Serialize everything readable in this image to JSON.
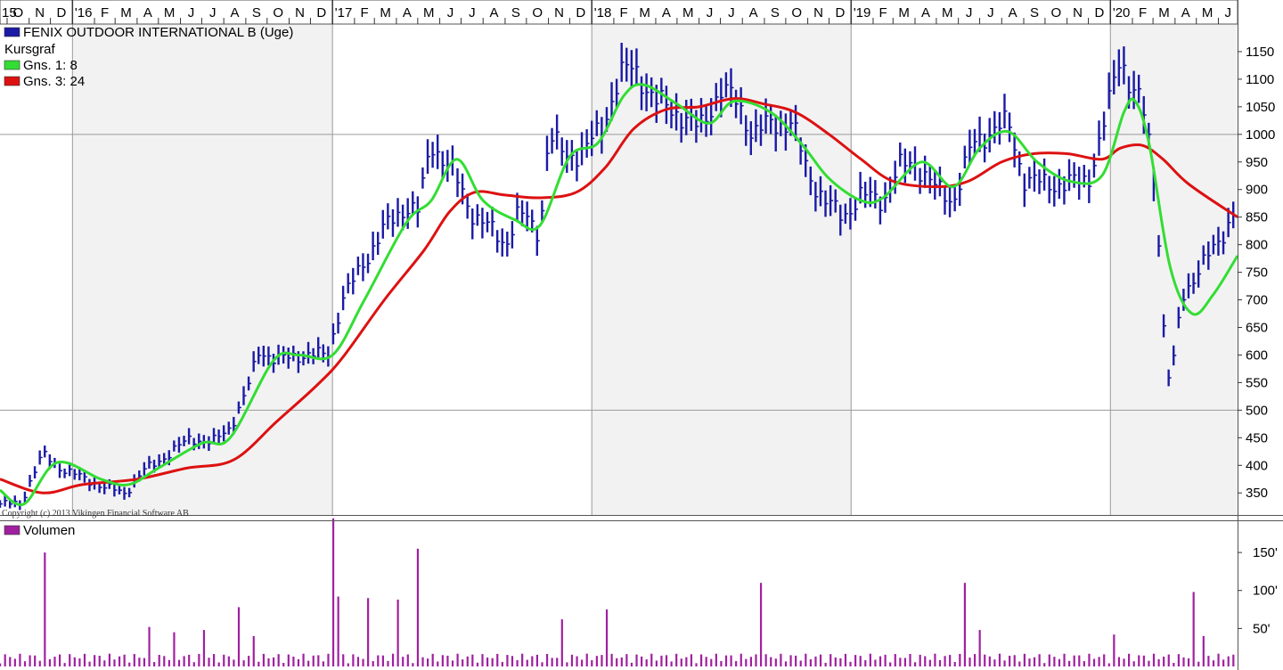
{
  "colors": {
    "price": "#1a1aa6",
    "ma_short": "#33dd33",
    "ma_long": "#dd1111",
    "volume": "#a020a0",
    "grid": "#9a9a9a",
    "band": "#f2f2f2"
  },
  "time_axis": {
    "labels": [
      "15",
      "O",
      "N",
      "D",
      "'16",
      "F",
      "M",
      "A",
      "M",
      "J",
      "J",
      "A",
      "S",
      "O",
      "N",
      "D",
      "'17",
      "F",
      "M",
      "A",
      "M",
      "J",
      "J",
      "A",
      "S",
      "O",
      "N",
      "D",
      "'18",
      "F",
      "M",
      "A",
      "M",
      "J",
      "J",
      "A",
      "S",
      "O",
      "N",
      "D",
      "'19",
      "F",
      "M",
      "A",
      "M",
      "J",
      "J",
      "A",
      "S",
      "O",
      "N",
      "D",
      "'20",
      "F",
      "M",
      "A",
      "M",
      "J"
    ]
  },
  "legend": {
    "title": "FENIX OUTDOOR INTERNATIONAL B (Uge)",
    "subtitle": "Kursgraf",
    "ma_short_label": "Gns. 1: 8",
    "ma_long_label": "Gns. 3: 24",
    "volume_label": "Volumen"
  },
  "copyright": "Copyright (c) 2013 Vikingen Financial Software AB",
  "chart_data": [
    {
      "type": "line",
      "title": "FENIX OUTDOOR INTERNATIONAL B (Uge)",
      "x_range": [
        "2015-09-21",
        "2020-06-28"
      ],
      "ylim": [
        310,
        1200
      ],
      "y_ticks": [
        350,
        400,
        450,
        500,
        550,
        600,
        650,
        700,
        750,
        800,
        850,
        900,
        950,
        1000,
        1050,
        1100,
        1150
      ],
      "y_gridlines": [
        500,
        1000
      ],
      "x_gridlines": [
        "2016-01-01",
        "2017-01-01",
        "2018-01-01",
        "2019-01-01",
        "2020-01-01"
      ],
      "series": [
        {
          "name": "FENIX OUTDOOR INTERNATIONAL B (Uge)",
          "style": "hlc-bars",
          "anchors": [
            [
              "2015-09-21",
              330
            ],
            [
              "2015-10-20",
              330
            ],
            [
              "2015-11-05",
              380
            ],
            [
              "2015-11-20",
              420
            ],
            [
              "2015-12-15",
              395
            ],
            [
              "2016-01-10",
              380
            ],
            [
              "2016-02-15",
              360
            ],
            [
              "2016-03-15",
              350
            ],
            [
              "2016-04-10",
              390
            ],
            [
              "2016-05-15",
              420
            ],
            [
              "2016-06-15",
              450
            ],
            [
              "2016-07-15",
              440
            ],
            [
              "2016-08-10",
              470
            ],
            [
              "2016-09-01",
              530
            ],
            [
              "2016-09-20",
              610
            ],
            [
              "2016-10-15",
              590
            ],
            [
              "2016-11-15",
              600
            ],
            [
              "2016-12-25",
              600
            ],
            [
              "2017-01-15",
              700
            ],
            [
              "2017-02-15",
              770
            ],
            [
              "2017-03-15",
              830
            ],
            [
              "2017-04-15",
              870
            ],
            [
              "2017-05-01",
              860
            ],
            [
              "2017-05-20",
              985
            ],
            [
              "2017-06-20",
              930
            ],
            [
              "2017-07-15",
              860
            ],
            [
              "2017-08-10",
              830
            ],
            [
              "2017-09-01",
              800
            ],
            [
              "2017-09-20",
              860
            ],
            [
              "2017-10-20",
              820
            ],
            [
              "2017-11-01",
              1000
            ],
            [
              "2017-11-25",
              960
            ],
            [
              "2017-12-20",
              970
            ],
            [
              "2018-01-15",
              1010
            ],
            [
              "2018-02-10",
              1110
            ],
            [
              "2018-03-01",
              1120
            ],
            [
              "2018-04-01",
              1060
            ],
            [
              "2018-05-01",
              1040
            ],
            [
              "2018-06-01",
              1010
            ],
            [
              "2018-07-01",
              1080
            ],
            [
              "2018-07-25",
              1060
            ],
            [
              "2018-08-15",
              1000
            ],
            [
              "2018-09-10",
              1020
            ],
            [
              "2018-10-10",
              1020
            ],
            [
              "2018-11-01",
              930
            ],
            [
              "2018-11-25",
              880
            ],
            [
              "2018-12-20",
              850
            ],
            [
              "2019-01-15",
              890
            ],
            [
              "2019-02-15",
              880
            ],
            [
              "2019-03-10",
              940
            ],
            [
              "2019-04-01",
              950
            ],
            [
              "2019-05-01",
              900
            ],
            [
              "2019-05-25",
              880
            ],
            [
              "2019-06-20",
              980
            ],
            [
              "2019-07-20",
              1010
            ],
            [
              "2019-08-10",
              1020
            ],
            [
              "2019-09-01",
              920
            ],
            [
              "2019-10-01",
              910
            ],
            [
              "2019-11-01",
              910
            ],
            [
              "2019-12-01",
              920
            ],
            [
              "2019-12-20",
              1000
            ],
            [
              "2020-01-15",
              1150
            ],
            [
              "2020-01-25",
              1100
            ],
            [
              "2020-02-15",
              1050
            ],
            [
              "2020-02-28",
              960
            ],
            [
              "2020-03-10",
              800
            ],
            [
              "2020-03-20",
              550
            ],
            [
              "2020-04-01",
              600
            ],
            [
              "2020-04-10",
              700
            ],
            [
              "2020-05-05",
              760
            ],
            [
              "2020-06-01",
              800
            ],
            [
              "2020-06-28",
              880
            ]
          ]
        },
        {
          "name": "Gns. 1: 8",
          "style": "smooth-line",
          "points": [
            [
              "2015-09-21",
              355
            ],
            [
              "2015-10-25",
              330
            ],
            [
              "2015-12-10",
              405
            ],
            [
              "2016-02-10",
              375
            ],
            [
              "2016-03-20",
              365
            ],
            [
              "2016-05-01",
              395
            ],
            [
              "2016-07-01",
              440
            ],
            [
              "2016-08-10",
              450
            ],
            [
              "2016-10-10",
              590
            ],
            [
              "2016-11-15",
              600
            ],
            [
              "2017-01-01",
              600
            ],
            [
              "2017-02-15",
              700
            ],
            [
              "2017-04-15",
              840
            ],
            [
              "2017-05-20",
              880
            ],
            [
              "2017-06-25",
              955
            ],
            [
              "2017-08-01",
              880
            ],
            [
              "2017-09-15",
              845
            ],
            [
              "2017-10-20",
              835
            ],
            [
              "2017-12-01",
              960
            ],
            [
              "2018-01-10",
              985
            ],
            [
              "2018-02-15",
              1070
            ],
            [
              "2018-03-15",
              1090
            ],
            [
              "2018-05-01",
              1055
            ],
            [
              "2018-06-15",
              1020
            ],
            [
              "2018-07-20",
              1060
            ],
            [
              "2018-09-10",
              1040
            ],
            [
              "2018-10-25",
              980
            ],
            [
              "2018-12-01",
              920
            ],
            [
              "2019-01-15",
              880
            ],
            [
              "2019-02-15",
              885
            ],
            [
              "2019-04-10",
              950
            ],
            [
              "2019-05-25",
              905
            ],
            [
              "2019-07-01",
              975
            ],
            [
              "2019-08-10",
              1005
            ],
            [
              "2019-09-20",
              950
            ],
            [
              "2019-11-05",
              915
            ],
            [
              "2019-12-20",
              925
            ],
            [
              "2020-01-20",
              1040
            ],
            [
              "2020-02-05",
              1060
            ],
            [
              "2020-02-25",
              980
            ],
            [
              "2020-03-25",
              760
            ],
            [
              "2020-04-25",
              675
            ],
            [
              "2020-05-25",
              710
            ],
            [
              "2020-06-28",
              780
            ]
          ]
        },
        {
          "name": "Gns. 3: 24",
          "style": "smooth-line",
          "points": [
            [
              "2015-09-21",
              375
            ],
            [
              "2015-11-20",
              350
            ],
            [
              "2016-01-15",
              365
            ],
            [
              "2016-04-01",
              375
            ],
            [
              "2016-06-10",
              395
            ],
            [
              "2016-08-15",
              410
            ],
            [
              "2016-10-15",
              480
            ],
            [
              "2016-12-10",
              545
            ],
            [
              "2017-01-15",
              595
            ],
            [
              "2017-03-15",
              700
            ],
            [
              "2017-05-10",
              790
            ],
            [
              "2017-06-15",
              860
            ],
            [
              "2017-07-20",
              895
            ],
            [
              "2017-09-01",
              890
            ],
            [
              "2017-10-20",
              885
            ],
            [
              "2017-12-10",
              895
            ],
            [
              "2018-01-20",
              940
            ],
            [
              "2018-03-01",
              1010
            ],
            [
              "2018-04-15",
              1045
            ],
            [
              "2018-06-01",
              1050
            ],
            [
              "2018-07-20",
              1065
            ],
            [
              "2018-09-01",
              1055
            ],
            [
              "2018-10-15",
              1040
            ],
            [
              "2018-12-01",
              1000
            ],
            [
              "2019-01-15",
              955
            ],
            [
              "2019-03-01",
              915
            ],
            [
              "2019-05-01",
              905
            ],
            [
              "2019-06-15",
              915
            ],
            [
              "2019-08-01",
              950
            ],
            [
              "2019-09-15",
              965
            ],
            [
              "2019-11-01",
              965
            ],
            [
              "2019-12-20",
              955
            ],
            [
              "2020-01-15",
              975
            ],
            [
              "2020-02-15",
              980
            ],
            [
              "2020-03-15",
              955
            ],
            [
              "2020-04-20",
              910
            ],
            [
              "2020-06-28",
              850
            ]
          ]
        }
      ]
    },
    {
      "type": "bar",
      "title": "Volumen",
      "ylim": [
        0,
        190
      ],
      "y_ticks": [
        50,
        100,
        150
      ],
      "y_tick_labels": [
        "50'",
        "100'",
        "150'"
      ],
      "series": [
        {
          "name": "Volumen",
          "baseline": 8,
          "spikes": [
            [
              "2015-11-20",
              150
            ],
            [
              "2016-04-15",
              52
            ],
            [
              "2016-05-20",
              45
            ],
            [
              "2016-07-01",
              48
            ],
            [
              "2016-08-20",
              78
            ],
            [
              "2016-09-10",
              40
            ],
            [
              "2017-01-05",
              195
            ],
            [
              "2017-01-12",
              92
            ],
            [
              "2017-02-20",
              90
            ],
            [
              "2017-04-05",
              88
            ],
            [
              "2017-05-01",
              155
            ],
            [
              "2017-11-20",
              62
            ],
            [
              "2018-01-25",
              75
            ],
            [
              "2018-08-25",
              110
            ],
            [
              "2019-06-10",
              110
            ],
            [
              "2019-07-01",
              48
            ],
            [
              "2020-01-05",
              42
            ],
            [
              "2020-04-25",
              98
            ],
            [
              "2020-05-10",
              40
            ]
          ]
        }
      ]
    }
  ]
}
